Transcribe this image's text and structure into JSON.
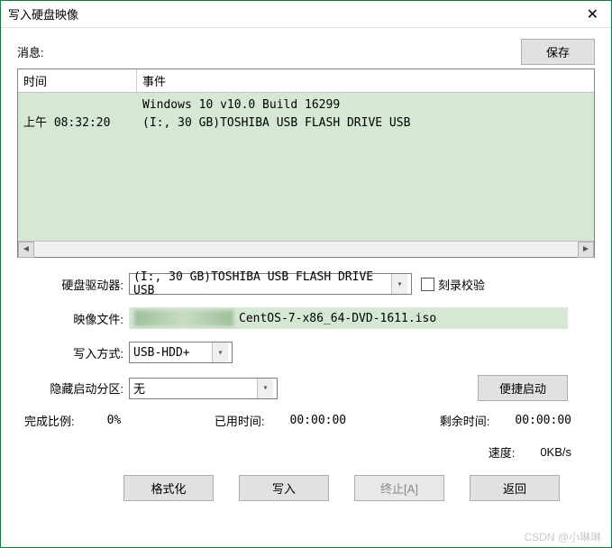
{
  "window": {
    "title": "写入硬盘映像"
  },
  "message": {
    "label": "消息:",
    "save_btn": "保存"
  },
  "log": {
    "headers": {
      "time": "时间",
      "event": "事件"
    },
    "rows": [
      {
        "time": "上午 08:32:20",
        "event": "Windows 10 v10.0 Build 16299\n(I:, 30 GB)TOSHIBA USB FLASH DRIVE USB"
      }
    ]
  },
  "form": {
    "drive_label": "硬盘驱动器:",
    "drive_value": "(I:, 30 GB)TOSHIBA USB FLASH DRIVE USB",
    "verify_label": "刻录校验",
    "image_label": "映像文件:",
    "image_value": "CentOS-7-x86_64-DVD-1611.iso",
    "write_mode_label": "写入方式:",
    "write_mode_value": "USB-HDD+",
    "hide_part_label": "隐藏启动分区:",
    "hide_part_value": "无",
    "quick_boot_btn": "便捷启动"
  },
  "stats": {
    "done_pct_label": "完成比例:",
    "done_pct_value": "0%",
    "elapsed_label": "已用时间:",
    "elapsed_value": "00:00:00",
    "remain_label": "剩余时间:",
    "remain_value": "00:00:00",
    "speed_label": "速度:",
    "speed_value": "0KB/s"
  },
  "actions": {
    "format": "格式化",
    "write": "写入",
    "abort": "终止[A]",
    "back": "返回"
  },
  "watermark": "CSDN @小琳琳"
}
